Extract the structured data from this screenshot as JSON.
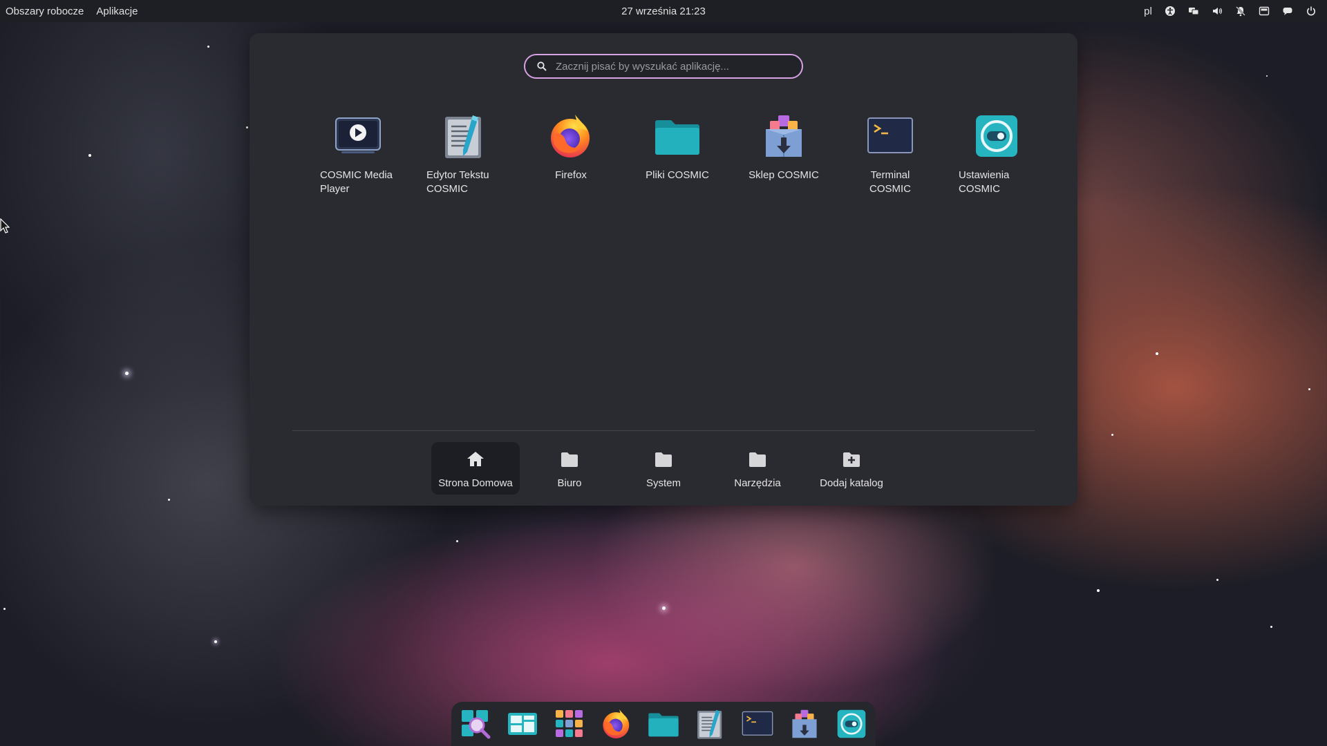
{
  "top_panel": {
    "workspaces_label": "Obszary robocze",
    "applications_label": "Aplikacje",
    "clock": "27 września 21:23",
    "language": "pl",
    "tray_icons": [
      "accessibility-icon",
      "network-icon",
      "volume-icon",
      "notifications-off-icon",
      "battery-icon",
      "chat-icon",
      "power-icon"
    ]
  },
  "launcher": {
    "search_placeholder": "Zacznij pisać by wyszukać aplikację...",
    "apps": [
      {
        "label": "COSMIC Media Player",
        "icon": "media-player-icon"
      },
      {
        "label": "Edytor Tekstu COSMIC",
        "icon": "text-editor-icon"
      },
      {
        "label": "Firefox",
        "icon": "firefox-icon"
      },
      {
        "label": "Pliki COSMIC",
        "icon": "files-icon"
      },
      {
        "label": "Sklep COSMIC",
        "icon": "store-icon"
      },
      {
        "label": "Terminal COSMIC",
        "icon": "terminal-icon"
      },
      {
        "label": "Ustawienia COSMIC",
        "icon": "settings-icon"
      }
    ],
    "folders": [
      {
        "label": "Strona Domowa",
        "icon": "home-icon"
      },
      {
        "label": "Biuro",
        "icon": "folder-icon"
      },
      {
        "label": "System",
        "icon": "folder-icon"
      },
      {
        "label": "Narzędzia",
        "icon": "folder-icon"
      },
      {
        "label": "Dodaj katalog",
        "icon": "add-folder-icon"
      }
    ]
  },
  "dock": {
    "items": [
      "launcher-icon",
      "workspaces-icon",
      "app-grid-icon",
      "firefox-icon",
      "files-icon",
      "text-editor-icon",
      "terminal-icon",
      "store-icon",
      "settings-icon"
    ]
  },
  "colors": {
    "panel_bg": "#1e1f24",
    "launcher_bg": "#2a2b31",
    "search_border": "#d8a2e4",
    "folder_teal": "#1fa9b5",
    "terminal_accent": "#f5b942"
  }
}
